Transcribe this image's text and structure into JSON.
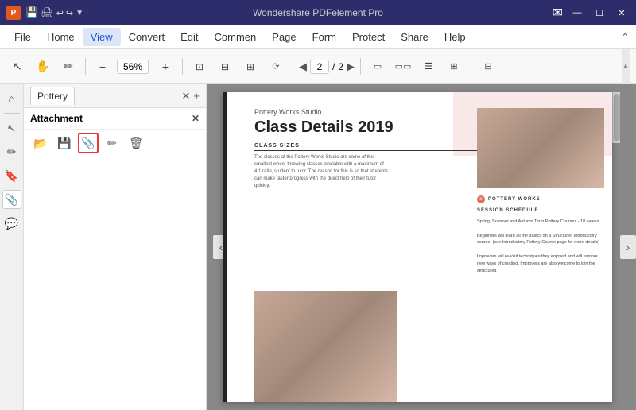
{
  "titlebar": {
    "title": "Wondershare PDFelement Pro",
    "icons_left": [
      "💾",
      "🖨",
      "↩",
      "↪"
    ],
    "email_icon": "✉",
    "win_minimize": "—",
    "win_maximize": "☐",
    "win_close": "✕"
  },
  "menubar": {
    "items": [
      "File",
      "Home",
      "View",
      "Convert",
      "Edit",
      "Commen",
      "Page",
      "Form",
      "Protect",
      "Share",
      "Help"
    ]
  },
  "toolbar": {
    "zoom_minus": "−",
    "zoom_value": "56%",
    "zoom_plus": "+",
    "page_prev": "◀",
    "page_current": "2",
    "page_separator": "/",
    "page_total": "2",
    "page_next": "▶"
  },
  "panel": {
    "tab_label": "Pottery",
    "tab_close": "✕",
    "tab_add": "+",
    "attachment_title": "Attachment",
    "attachment_close": "✕",
    "att_buttons": [
      "open",
      "save",
      "attach",
      "edit",
      "delete"
    ]
  },
  "document": {
    "studio_name": "Pottery Works Studio",
    "main_title": "Class Details 2019",
    "class_label": "CLASS SIZES",
    "class_desc": "The classes at the Pottery Works Studio are some of the smallest wheel-throwing classes available with a maximum of 4:1 ratio, student to tutor. The reason for this is so that students can make faster progress with the direct help of their tutor quickly.",
    "logo_text": "POTTERY WORKS",
    "session_label": "SESSION SCHEDULE",
    "session_text": "Spring, Summer and Autumn Term Pottery Courses - 10 weeks\n\nBeginners will learn all the basics on a Structured Introductory course, (see Introductory Pottery Course page for more details)\n\nImprovers will re-visit techniques they enjoyed and will explore new ways of creating. Improvers are also welcome to join the structured"
  },
  "left_icons": {
    "home": "⌂",
    "select": "↖",
    "edit": "✏",
    "bookmark": "🔖",
    "attachment": "📎",
    "comment": "💬"
  }
}
